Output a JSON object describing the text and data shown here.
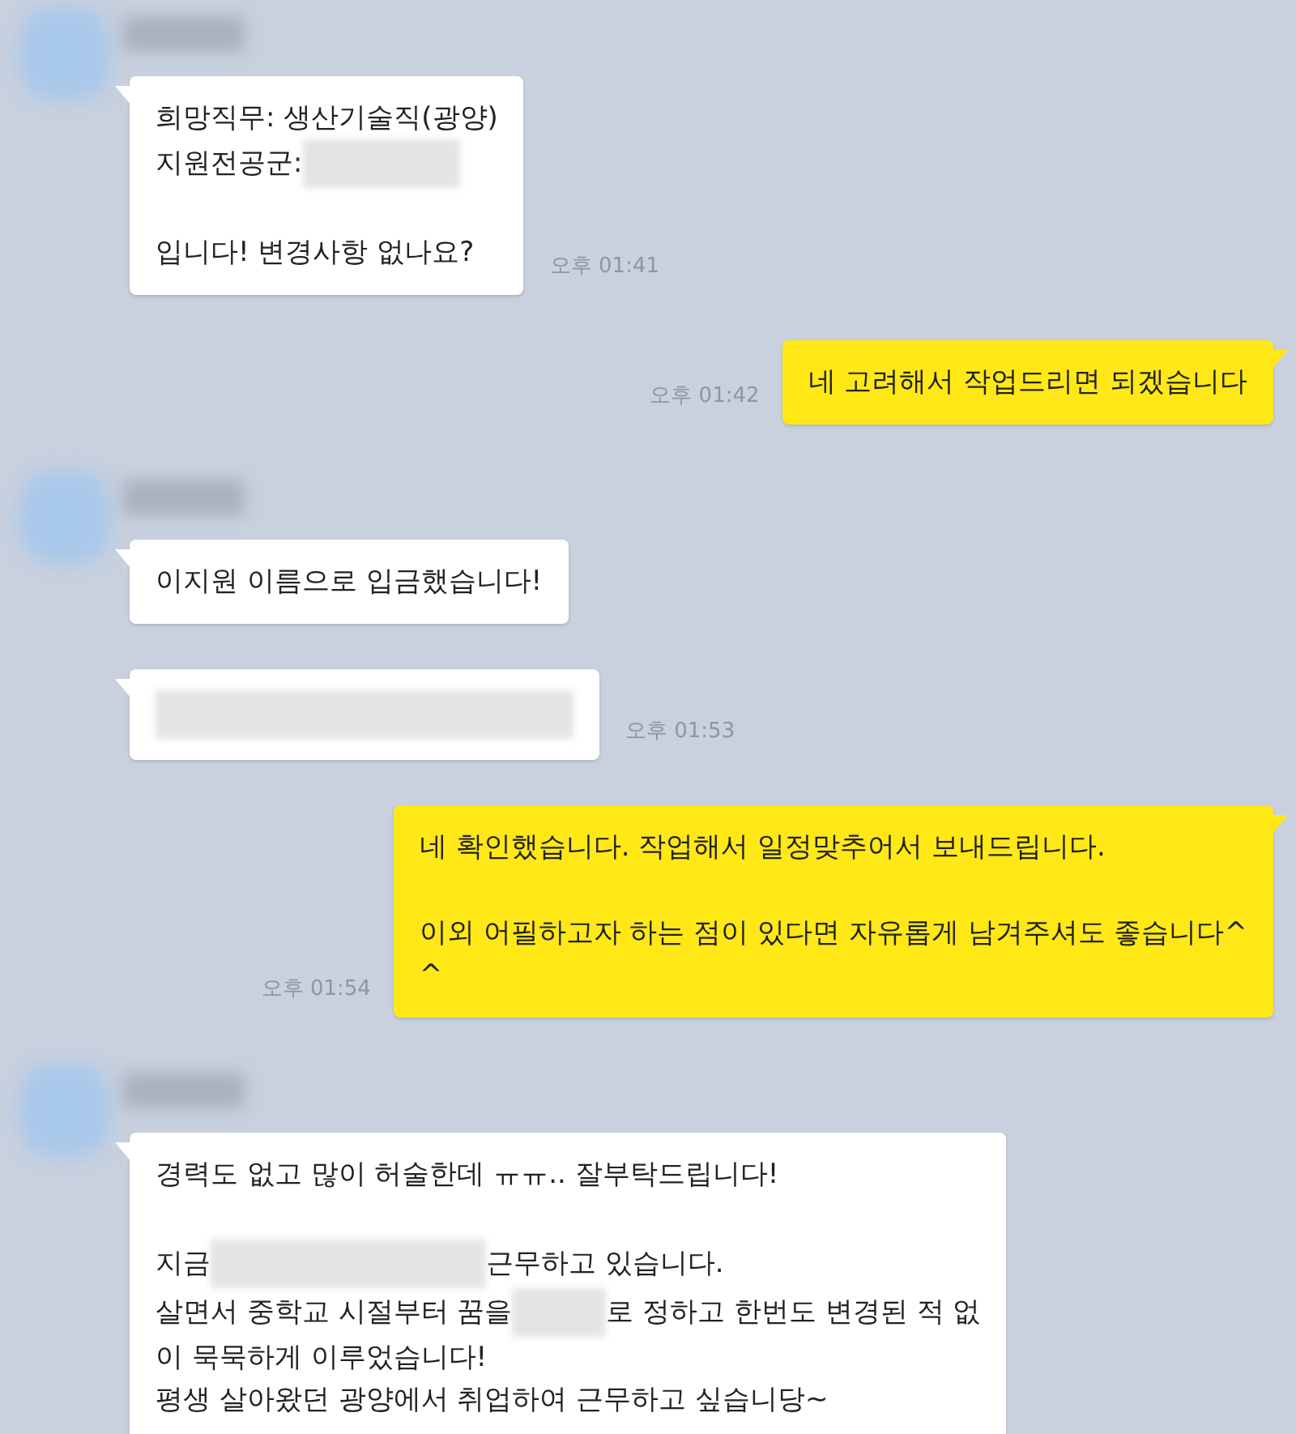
{
  "messages": [
    {
      "kind": "incoming",
      "show_profile": true,
      "time": "오후 01:41",
      "paragraphs": [
        [
          [
            {
              "kind": "text",
              "text": "희망직무: 생산기술직(광양)"
            }
          ],
          [
            {
              "kind": "text",
              "text": "지원전공군:"
            },
            {
              "kind": "redacted_medium"
            }
          ]
        ],
        [
          [
            {
              "kind": "text",
              "text": "입니다! 변경사항 없나요?"
            }
          ]
        ]
      ]
    },
    {
      "kind": "outgoing",
      "show_profile": false,
      "time": "오후 01:42",
      "paragraphs": [
        [
          [
            {
              "kind": "text",
              "text": "네 고려해서 작업드리면 되겠습니다"
            }
          ]
        ]
      ]
    },
    {
      "kind": "incoming",
      "show_profile": true,
      "paragraphs": [
        [
          [
            {
              "kind": "text",
              "text": "이지원 이름으로 입금했습니다!"
            }
          ]
        ]
      ]
    },
    {
      "kind": "incoming",
      "show_profile": false,
      "time": "오후 01:53",
      "paragraphs": [
        [
          [
            {
              "kind": "redacted_full"
            }
          ]
        ]
      ]
    },
    {
      "kind": "outgoing",
      "show_profile": false,
      "time": "오후 01:54",
      "paragraphs": [
        [
          [
            {
              "kind": "text",
              "text": "네 확인했습니다. 작업해서 일정맞추어서 보내드립니다."
            }
          ]
        ],
        [
          [
            {
              "kind": "text",
              "text": "이외 어필하고자 하는 점이 있다면 자유롭게 남겨주셔도 좋습니다^"
            }
          ],
          [
            {
              "kind": "text",
              "text": "^"
            }
          ]
        ]
      ]
    },
    {
      "kind": "incoming",
      "show_profile": true,
      "paragraphs": [
        [
          [
            {
              "kind": "text",
              "text": "경력도 없고 많이 허술한데 ㅠㅠ.. 잘부탁드립니다!"
            }
          ]
        ],
        [
          [
            {
              "kind": "text",
              "text": "지금"
            },
            {
              "kind": "redacted_long"
            },
            {
              "kind": "text",
              "text": "근무하고 있습니다."
            }
          ],
          [
            {
              "kind": "text",
              "text": "살면서 중학교 시절부터 꿈을"
            },
            {
              "kind": "redacted_short"
            },
            {
              "kind": "text",
              "text": "로 정하고 한번도 변경된 적 없"
            }
          ],
          [
            {
              "kind": "text",
              "text": "이 묵묵하게 이루었습니다!"
            }
          ],
          [
            {
              "kind": "text",
              "text": "평생 살아왔던 광양에서 취업하여 근무하고 싶습니당~"
            }
          ]
        ]
      ]
    }
  ]
}
